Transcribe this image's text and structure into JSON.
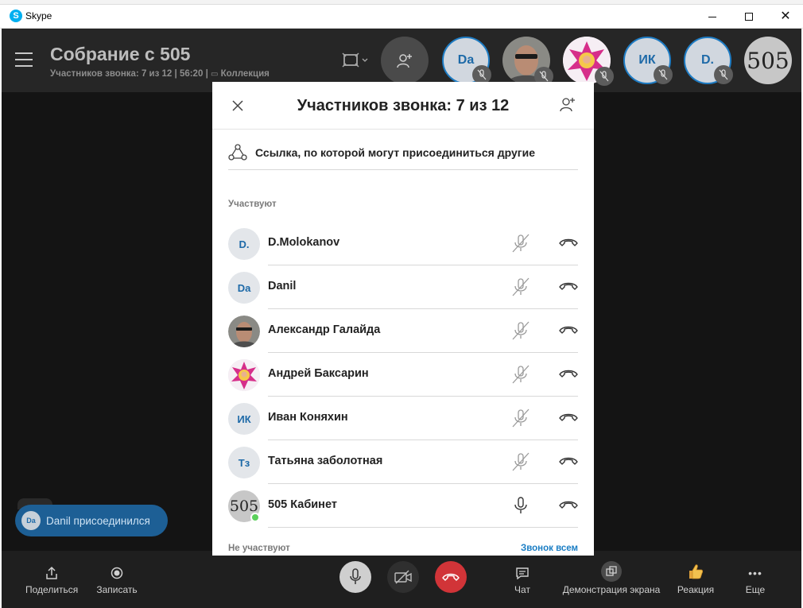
{
  "window": {
    "app_title": "Skype",
    "icon_letter": "S"
  },
  "header": {
    "title": "Собрание с 505",
    "subtitle_count": "Участников звонка: 7 из 12",
    "duration": "56:20",
    "collection": "Коллекция",
    "separator": "|",
    "avatars": [
      {
        "initials": "Da",
        "kind": "initials"
      },
      {
        "initials": "",
        "kind": "photo-man"
      },
      {
        "initials": "",
        "kind": "photo-star"
      },
      {
        "initials": "ИК",
        "kind": "initials"
      },
      {
        "initials": "D.",
        "kind": "initials"
      },
      {
        "initials": "505",
        "kind": "text505"
      }
    ]
  },
  "toast": {
    "initials": "Da",
    "message": "Danil присоединился"
  },
  "toolbar": {
    "share": "Поделиться",
    "record": "Записать",
    "chat": "Чат",
    "screen_share": "Демонстрация экрана",
    "reaction": "Реакция",
    "more": "Еще"
  },
  "modal": {
    "title": "Участников звонка: 7 из 12",
    "invite_link": "Ссылка, по которой могут присоединиться другие",
    "section_in_call": "Участвуют",
    "section_not_in_call": "Не участвуют",
    "call_all": "Звонок всем",
    "participants": [
      {
        "initials": "D.",
        "name": "D.Molokanov",
        "muted": true,
        "avatar": "initials"
      },
      {
        "initials": "Da",
        "name": "Danil",
        "muted": true,
        "avatar": "initials"
      },
      {
        "initials": "",
        "name": "Александр Галайда",
        "muted": true,
        "avatar": "photo-man"
      },
      {
        "initials": "",
        "name": "Андрей Баксарин",
        "muted": true,
        "avatar": "photo-star"
      },
      {
        "initials": "ИК",
        "name": "Иван Коняхин",
        "muted": true,
        "avatar": "initials"
      },
      {
        "initials": "Тз",
        "name": "Татьяна заболотная",
        "muted": true,
        "avatar": "initials"
      },
      {
        "initials": "505",
        "name": "505 Кабинет",
        "muted": false,
        "avatar": "text505",
        "online": true
      }
    ]
  },
  "colors": {
    "accent": "#1a7dc4",
    "hangup": "#d13438",
    "online": "#5cd15c"
  }
}
